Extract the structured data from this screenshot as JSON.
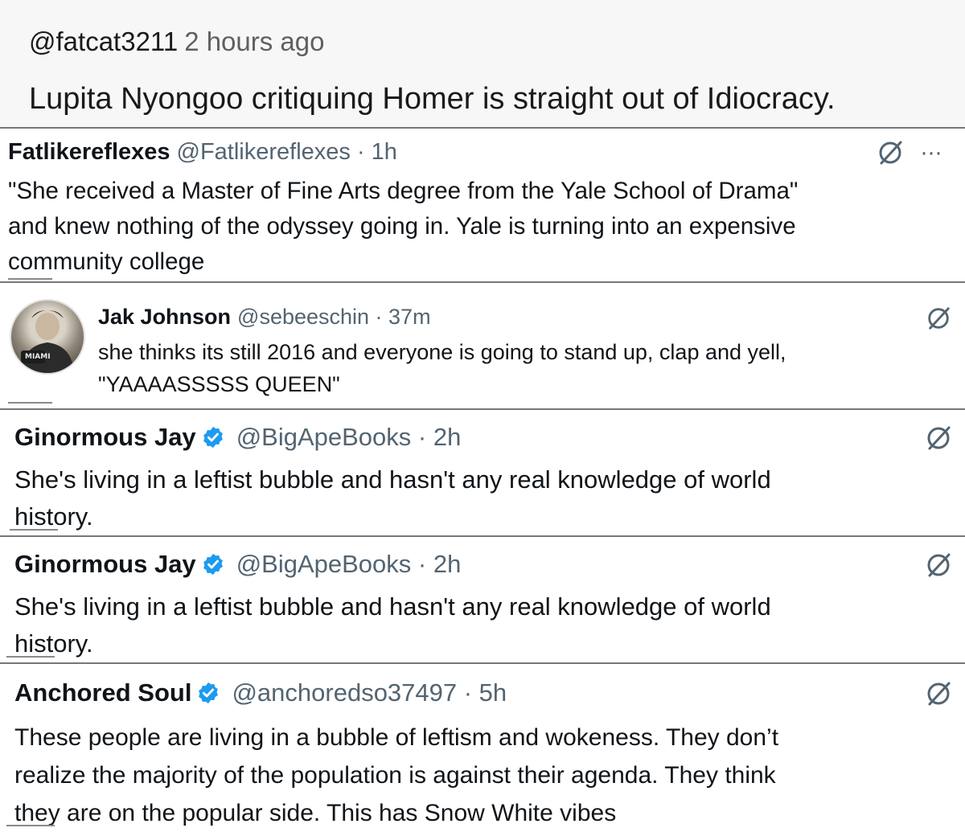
{
  "top_comment": {
    "handle": "@fatcat3211",
    "time": "2 hours ago",
    "text": "Lupita Nyongoo critiquing Homer is straight out of Idiocracy."
  },
  "tweets": [
    {
      "name": "Fatlikereflexes",
      "handle": "@Fatlikereflexes · 1h",
      "verified": false,
      "lines": [
        "\"She received a Master of Fine Arts degree from the Yale School of Drama\"",
        "and knew nothing of the odyssey going in. Yale is turning into an expensive",
        "community college"
      ],
      "more_label": "···"
    },
    {
      "name": "Jak Johnson",
      "handle": "@sebeeschin · 37m",
      "verified": false,
      "avatar_text": "MIAMI",
      "lines": [
        "she thinks its still 2016 and everyone is going to stand up, clap and yell,",
        "\"YAAAASSSSS QUEEN\""
      ]
    },
    {
      "name": "Ginormous Jay",
      "handle": "@BigApeBooks · 2h",
      "verified": true,
      "lines": [
        "She's living in a leftist bubble and hasn't any real knowledge of world",
        "history."
      ]
    },
    {
      "name": "Ginormous Jay",
      "handle": "@BigApeBooks · 2h",
      "verified": true,
      "lines": [
        "She's living in a leftist bubble and hasn't any real knowledge of world",
        "history."
      ]
    },
    {
      "name": "Anchored Soul",
      "handle": "@anchoredso37497 · 5h",
      "verified": true,
      "lines": [
        "These people are living in a bubble of leftism and wokeness. They don’t",
        "realize the majority of the population is against their agenda. They think",
        "they are on the popular side. This has Snow White vibes"
      ]
    }
  ],
  "colors": {
    "text": "#0f1419",
    "secondary": "#536471",
    "verified": "#1d9bf0",
    "separator": "#777777"
  },
  "icons": [
    "grok-icon",
    "more-icon",
    "verified-badge-icon"
  ]
}
